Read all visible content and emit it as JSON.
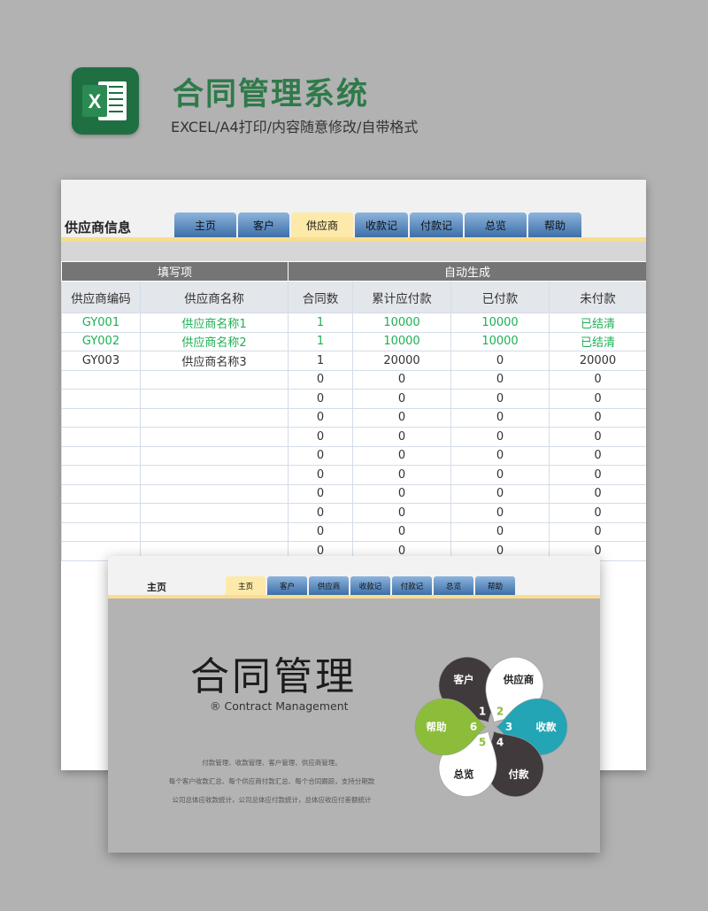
{
  "header": {
    "title": "合同管理系统",
    "subtitle": "EXCEL/A4打印/内容随意修改/自带格式",
    "logo_icon": "excel-icon",
    "logo_color": "#1f6f43"
  },
  "sheet": {
    "title": "供应商信息",
    "tabs": [
      "主页",
      "客户",
      "供应商",
      "收款记",
      "付款记",
      "总览",
      "帮助"
    ],
    "active_tab": "供应商",
    "groups": [
      "填写项",
      "自动生成"
    ],
    "columns": [
      "供应商编码",
      "供应商名称",
      "合同数",
      "累计应付款",
      "已付款",
      "未付款"
    ],
    "rows": [
      [
        "GY001",
        "供应商名称1",
        "1",
        "10000",
        "10000",
        "已结清"
      ],
      [
        "GY002",
        "供应商名称2",
        "1",
        "10000",
        "10000",
        "已结清"
      ],
      [
        "GY003",
        "供应商名称3",
        "1",
        "20000",
        "0",
        "20000"
      ],
      [
        "",
        "",
        "0",
        "0",
        "0",
        "0"
      ],
      [
        "",
        "",
        "0",
        "0",
        "0",
        "0"
      ],
      [
        "",
        "",
        "0",
        "0",
        "0",
        "0"
      ],
      [
        "",
        "",
        "0",
        "0",
        "0",
        "0"
      ],
      [
        "",
        "",
        "0",
        "0",
        "0",
        "0"
      ],
      [
        "",
        "",
        "0",
        "0",
        "0",
        "0"
      ],
      [
        "",
        "",
        "0",
        "0",
        "0",
        "0"
      ],
      [
        "",
        "",
        "0",
        "0",
        "0",
        "0"
      ],
      [
        "",
        "",
        "0",
        "0",
        "0",
        "0"
      ],
      [
        "",
        "",
        "0",
        "0",
        "0",
        "0"
      ]
    ],
    "green_color": "#1db054"
  },
  "dashboard": {
    "title": "主页",
    "tabs": [
      "主页",
      "客户",
      "供应商",
      "收款记",
      "付款记",
      "总览",
      "帮助"
    ],
    "active_tab": "主页",
    "big_title": "合同管理",
    "big_subtitle": "® Contract Management",
    "desc_lines": [
      "付款管理、收款管理、客户管理、供应商管理。",
      "每个客户收款汇总、每个供应商付款汇总、每个合同跟踪，支持分期款",
      "公司总体应收款统计，公司总体应付款统计，总体应收应付差额统计"
    ],
    "petals": [
      {
        "label": "客户",
        "num": "1",
        "color": "#403a3c"
      },
      {
        "label": "供应商",
        "num": "2",
        "color": "#ffffff"
      },
      {
        "label": "收款",
        "num": "3",
        "color": "#24a5b5"
      },
      {
        "label": "付款",
        "num": "4",
        "color": "#403a3c"
      },
      {
        "label": "总览",
        "num": "5",
        "color": "#ffffff"
      },
      {
        "label": "帮助",
        "num": "6",
        "color": "#8cbd3a"
      }
    ]
  }
}
